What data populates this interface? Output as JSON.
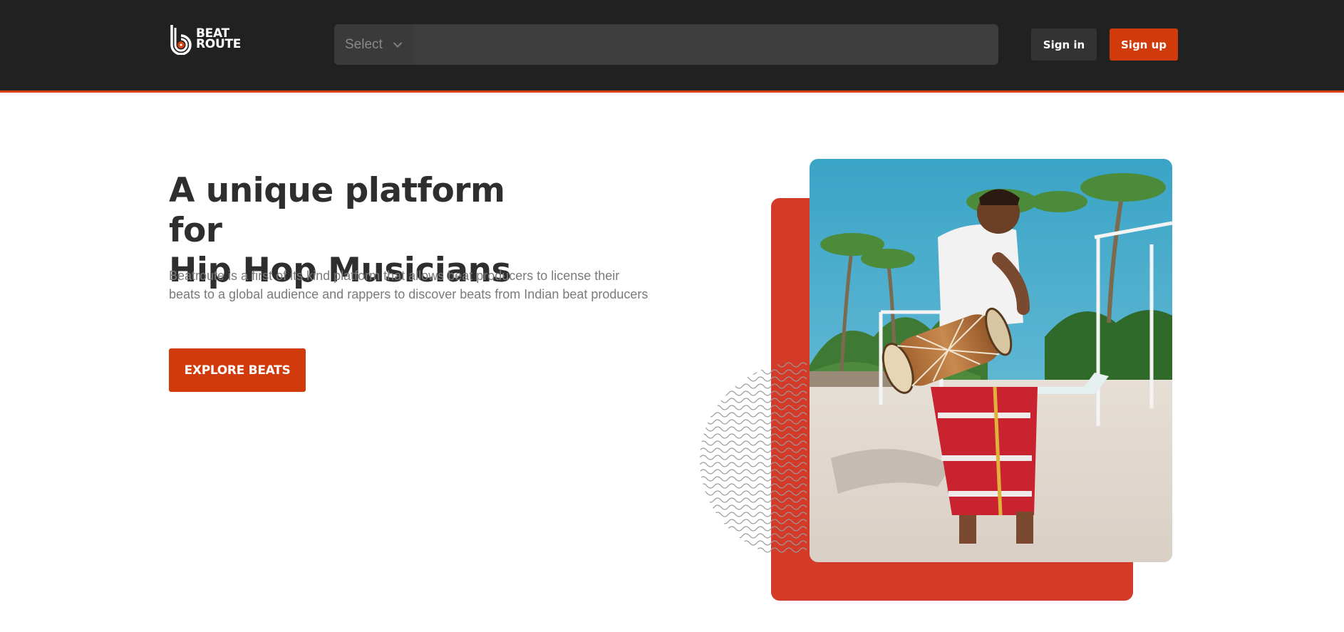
{
  "header": {
    "logo_line1": "BEAT",
    "logo_line2": "ROUTE",
    "search": {
      "select_label": "Select",
      "input_value": "",
      "input_placeholder": ""
    },
    "signin_label": "Sign in",
    "signup_label": "Sign up"
  },
  "hero": {
    "title_line1": "A unique platform for",
    "title_line2": "Hip Hop Musicians",
    "description": "Beatroute is a first of its kind platform that allows beat producers to license their beats to a global audience and rappers to discover beats from Indian beat producers",
    "cta_label": "EXPLORE BEATS"
  },
  "colors": {
    "header_bg": "#212121",
    "accent": "#d13a0b",
    "card_red": "#d33a27"
  },
  "icons": {
    "logo": "beatroute-logo-icon",
    "select": "chevron-down-icon",
    "waves": "wave-pattern-icon"
  }
}
